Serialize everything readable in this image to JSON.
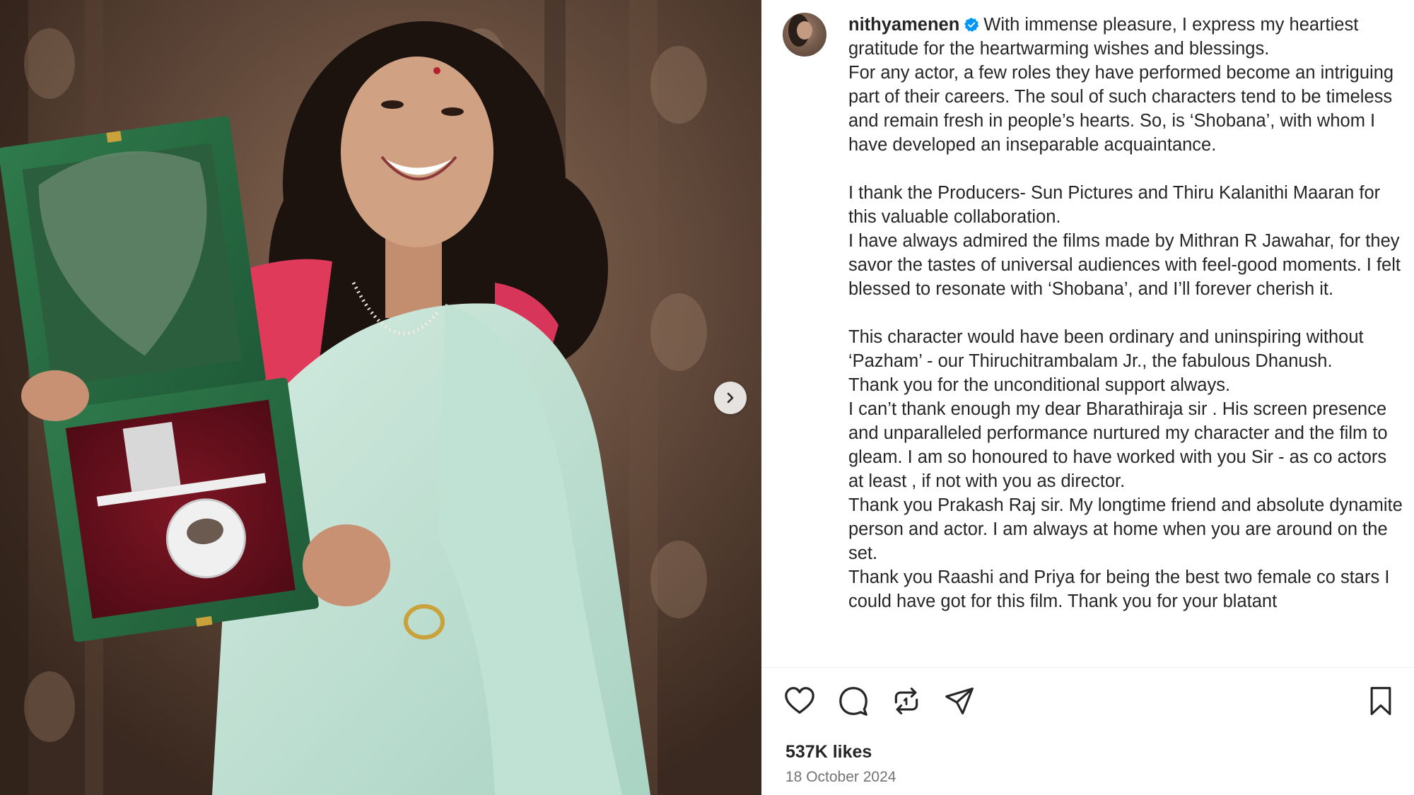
{
  "post": {
    "username": "nithyamenen",
    "caption_paragraphs": [
      "With immense pleasure, I express my heartiest gratitude for the heartwarming wishes and blessings.",
      "For any actor, a few roles they have performed become an intriguing part of their careers. The soul of such characters tend to be timeless and remain fresh in people’s hearts. So, is ‘Shobana’, with whom I have developed an inseparable acquaintance.",
      "",
      "I thank the Producers- Sun Pictures and Thiru Kalanithi Maaran for this valuable collaboration.",
      "I have always admired the films made by Mithran R Jawahar, for they savor the tastes of universal audiences with feel-good moments. I felt blessed to resonate with ‘Shobana’, and I’ll forever cherish it.",
      "",
      "This character would have been ordinary and uninspiring without ‘Pazham’ - our Thiruchitrambalam Jr., the fabulous Dhanush.",
      "Thank you for the unconditional support always.",
      "I can’t thank enough my dear Bharathiraja sir . His screen presence and unparalleled performance nurtured my character and the film to gleam. I am so honoured to have worked with you Sir - as co actors at least , if not with you as director.",
      "Thank you Prakash Raj sir. My longtime friend and absolute dynamite person and actor. I am always at home when you are around on the set.",
      "Thank you Raashi and Priya for being the best two female co stars I could have got for this film. Thank you for your blatant"
    ],
    "likes": "537K likes",
    "date": "18 October 2024"
  },
  "icons": {
    "verified": "verified-badge-icon",
    "like": "heart-icon",
    "comment": "comment-icon",
    "repost": "repost-icon",
    "share": "send-icon",
    "save": "bookmark-icon",
    "carousel_next": "chevron-right-icon"
  },
  "colors": {
    "verified_blue": "#0095f6",
    "text": "#262626",
    "secondary_text": "#737373"
  }
}
